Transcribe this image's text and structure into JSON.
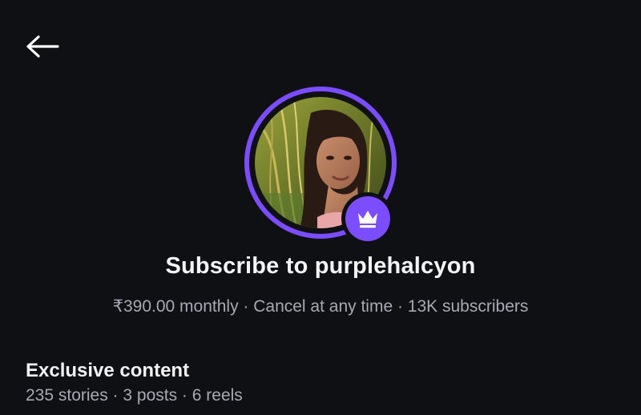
{
  "header": {
    "back_icon": "arrow-left-icon"
  },
  "profile": {
    "ring_color": "#7b4dff",
    "badge_icon": "crown-icon",
    "badge_color": "#7b4dff"
  },
  "subscribe": {
    "title": "Subscribe to purplehalcyon",
    "details": "₹390.00 monthly · Cancel at any time · 13K subscribers"
  },
  "exclusive": {
    "title": "Exclusive content",
    "stats": "235 stories · 3 posts · 6 reels"
  }
}
